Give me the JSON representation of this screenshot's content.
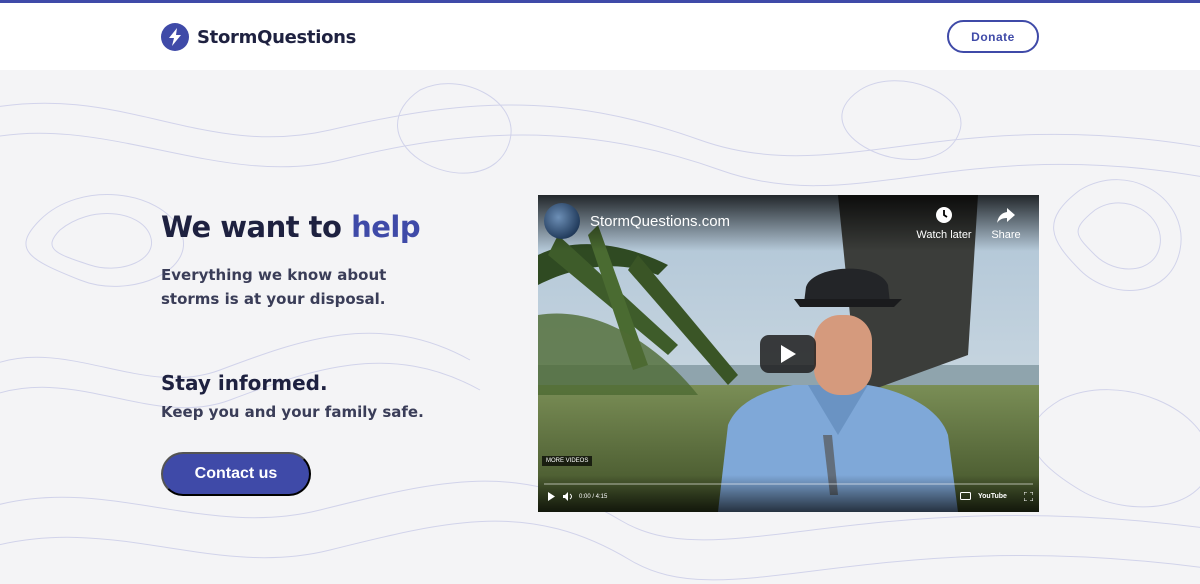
{
  "header": {
    "brand": "StormQuestions",
    "donate_label": "Donate"
  },
  "hero": {
    "title_main": "We want to ",
    "title_accent": "help",
    "subtitle": "Everything we know about storms is at your disposal."
  },
  "info": {
    "title": "Stay informed.",
    "subtitle": "Keep you and your family safe."
  },
  "cta": {
    "contact_label": "Contact us"
  },
  "video": {
    "title": "StormQuestions.com",
    "watch_later_label": "Watch later",
    "share_label": "Share",
    "more_videos_label": "MORE VIDEOS",
    "time_display": "0:00 / 4:15",
    "brand_label": "YouTube"
  },
  "icons": {
    "logo": "lightning-bolt-icon",
    "watch_later": "clock-icon",
    "share": "share-arrow-icon",
    "play": "play-icon"
  },
  "colors": {
    "brand": "#3f4aa8",
    "text_dark": "#1e2140",
    "background": "#f4f4f6"
  }
}
